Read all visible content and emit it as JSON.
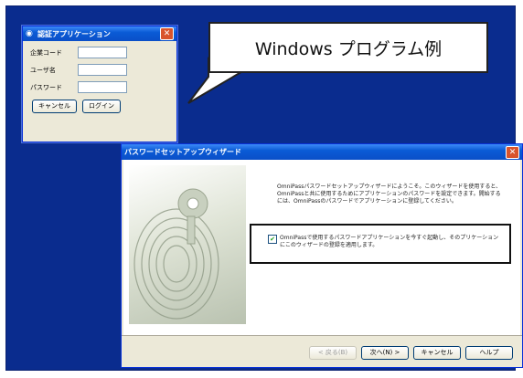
{
  "callout": {
    "text": "Windows プログラム例"
  },
  "login_window": {
    "title": "認証アプリケーション",
    "fields": [
      {
        "label": "企業コード",
        "value": ""
      },
      {
        "label": "ユーザ名",
        "value": ""
      },
      {
        "label": "パスワード",
        "value": ""
      }
    ],
    "cancel_label": "キャンセル",
    "login_label": "ログイン"
  },
  "wizard": {
    "title": "パスワードセットアップウィザード",
    "description": "OmniPassパスワードセットアップウィザードにようこそ。このウィザードを使用すると、OmniPassと共に使用するためにアプリケーションのパスワードを設定できます。開始するには、OmniPassのパスワードでアプリケーションに登録してください。",
    "checkbox_label": "OmniPassで使用するパスワードアプリケーションを今すぐ起動し、そのプリケーションにこのウィザードの登録を適用します。",
    "checkbox_checked": true,
    "buttons": {
      "back": "< 戻る(B)",
      "next": "次へ(N) >",
      "cancel": "キャンセル",
      "help": "ヘルプ"
    }
  },
  "colors": {
    "desktop": "#0a2c8e",
    "titlebar": "#0a5bd6",
    "window": "#ece9d8"
  },
  "icons": {
    "login_app": "fingerprint-app-icon",
    "close": "close-icon",
    "art": "fingerprint-art"
  }
}
